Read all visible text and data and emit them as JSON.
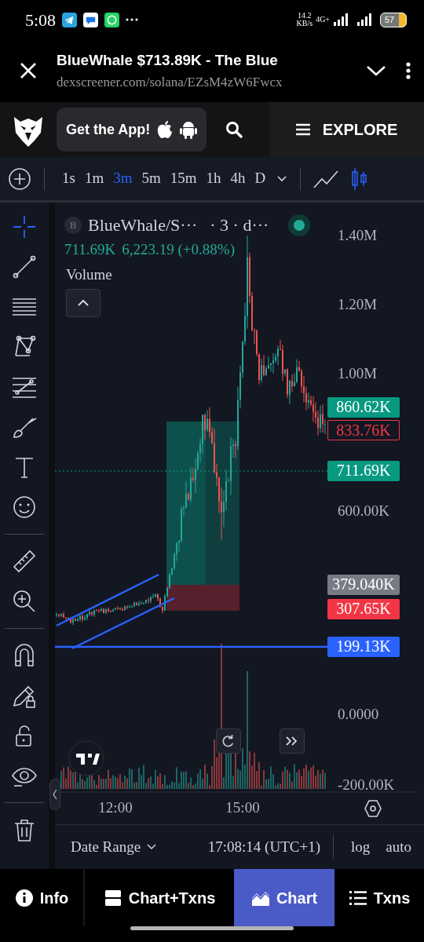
{
  "status_bar": {
    "time": "5:08",
    "speed_value": "14.2",
    "speed_unit": "KB/s",
    "network": "4G+",
    "battery": "57"
  },
  "browser": {
    "title": "BlueWhale $713.89K - The Blue",
    "url": "dexscreener.com/solana/EZsM4zW6Fwcx"
  },
  "site_header": {
    "app_button": "Get the App!",
    "explore": "EXPLORE"
  },
  "timeframes": [
    {
      "label": "1s",
      "selected": false
    },
    {
      "label": "1m",
      "selected": false
    },
    {
      "label": "3m",
      "selected": true
    },
    {
      "label": "5m",
      "selected": false
    },
    {
      "label": "15m",
      "selected": false
    },
    {
      "label": "1h",
      "selected": false
    },
    {
      "label": "4h",
      "selected": false
    },
    {
      "label": "D",
      "selected": false
    }
  ],
  "chart": {
    "badge": "B",
    "symbol": "BlueWhale/S···",
    "interval": "· 3 · d···",
    "legend_price": "711.69K",
    "legend_change": "6,223.19 (+0.88%)",
    "volume_label": "Volume",
    "price_axis": [
      "1.40M",
      "1.20M",
      "1.00M",
      "600.00K",
      "0.0000",
      "-200.00K"
    ],
    "price_tags": [
      {
        "text": "860.62K",
        "kind": "filled",
        "color": "#089981"
      },
      {
        "text": "833.76K",
        "kind": "outlined",
        "color": "#f23645"
      },
      {
        "text": "711.69K",
        "kind": "filled",
        "color": "#089981"
      },
      {
        "text": "379.040K",
        "kind": "filled",
        "color": "#787b86"
      },
      {
        "text": "307.65K",
        "kind": "filled",
        "color": "#f23645"
      },
      {
        "text": "199.13K",
        "kind": "filled",
        "color": "#2962ff"
      }
    ],
    "time_axis": [
      "12:00",
      "15:00"
    ]
  },
  "bottom_bar": {
    "date_range": "Date Range",
    "clock": "17:08:14 (UTC+1)",
    "log": "log",
    "auto": "auto"
  },
  "tabs": [
    {
      "label": "Info",
      "selected": false
    },
    {
      "label": "Chart+Txns",
      "selected": false
    },
    {
      "label": "Chart",
      "selected": true
    },
    {
      "label": "Txns",
      "selected": false
    }
  ]
}
